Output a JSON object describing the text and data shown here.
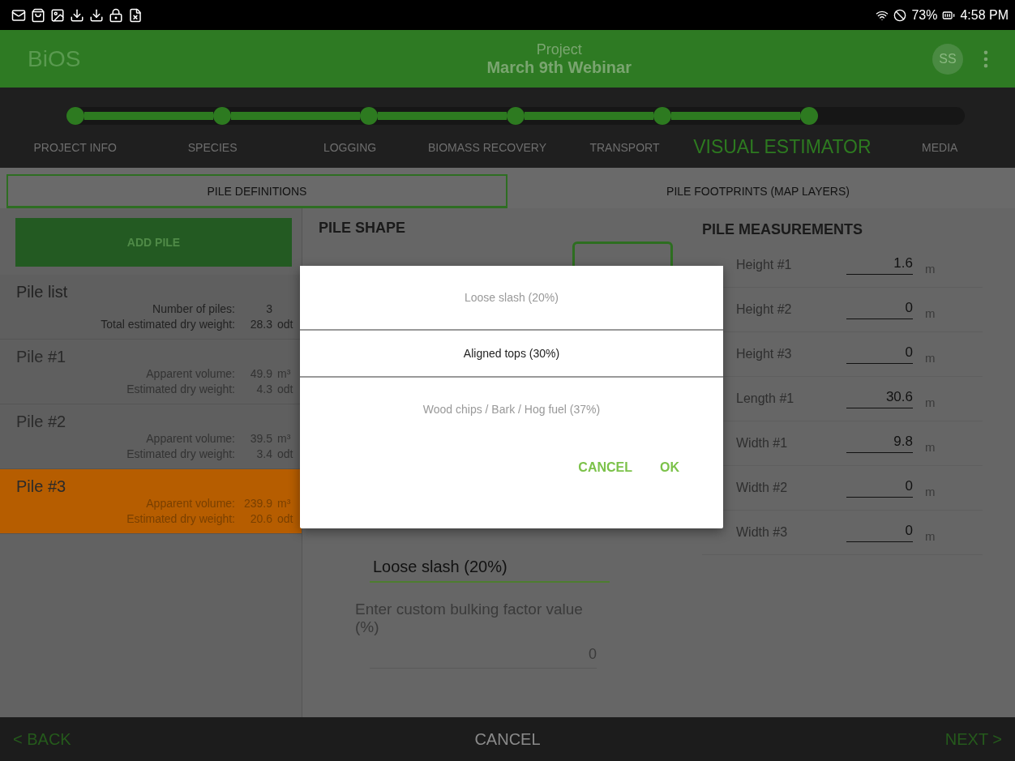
{
  "status_bar": {
    "battery": "73%",
    "time": "4:58 PM"
  },
  "header": {
    "app_name": "BiOS",
    "subtitle": "Project",
    "title": "March 9th Webinar",
    "avatar": "SS"
  },
  "steps": [
    {
      "label": "PROJECT INFO",
      "reached": true,
      "selected": false
    },
    {
      "label": "SPECIES",
      "reached": true,
      "selected": false
    },
    {
      "label": "LOGGING",
      "reached": true,
      "selected": false
    },
    {
      "label": "BIOMASS RECOVERY",
      "reached": true,
      "selected": false
    },
    {
      "label": "TRANSPORT",
      "reached": true,
      "selected": false
    },
    {
      "label": "VISUAL ESTIMATOR",
      "reached": true,
      "selected": true
    },
    {
      "label": "MEDIA",
      "reached": false,
      "selected": false
    }
  ],
  "tabs": [
    {
      "label": "PILE DEFINITIONS",
      "selected": true
    },
    {
      "label": "PILE FOOTPRINTS (MAP LAYERS)",
      "selected": false
    }
  ],
  "add_pile": "ADD PILE",
  "pile_list": {
    "title": "Pile list",
    "rows": [
      {
        "label": "Number of piles:",
        "value": "3",
        "unit": ""
      },
      {
        "label": "Total estimated dry weight:",
        "value": "28.3",
        "unit": "odt"
      }
    ]
  },
  "piles": [
    {
      "name": "Pile #1",
      "selected": false,
      "rows": [
        {
          "label": "Apparent volume:",
          "value": "49.9",
          "unit": "m³"
        },
        {
          "label": "Estimated dry weight:",
          "value": "4.3",
          "unit": "odt"
        }
      ]
    },
    {
      "name": "Pile #2",
      "selected": false,
      "rows": [
        {
          "label": "Apparent volume:",
          "value": "39.5",
          "unit": "m³"
        },
        {
          "label": "Estimated dry weight:",
          "value": "3.4",
          "unit": "odt"
        }
      ]
    },
    {
      "name": "Pile #3",
      "selected": true,
      "rows": [
        {
          "label": "Apparent volume:",
          "value": "239.9",
          "unit": "m³"
        },
        {
          "label": "Estimated dry weight:",
          "value": "20.6",
          "unit": "odt"
        }
      ]
    }
  ],
  "pile_shape": {
    "title": "PILE SHAPE",
    "bulking_factor": "Loose slash (20%)",
    "custom_label": "Enter custom bulking factor value (%)",
    "custom_value": "0"
  },
  "measurements": {
    "title": "PILE MEASUREMENTS",
    "rows": [
      {
        "label": "Height #1",
        "value": "1.6",
        "unit": "m"
      },
      {
        "label": "Height #2",
        "value": "0",
        "unit": "m"
      },
      {
        "label": "Height #3",
        "value": "0",
        "unit": "m"
      },
      {
        "label": "Length #1",
        "value": "30.6",
        "unit": "m"
      },
      {
        "label": "Width #1",
        "value": "9.8",
        "unit": "m"
      },
      {
        "label": "Width #2",
        "value": "0",
        "unit": "m"
      },
      {
        "label": "Width #3",
        "value": "0",
        "unit": "m"
      }
    ]
  },
  "footer": {
    "back": "< BACK",
    "cancel": "CANCEL",
    "next": "NEXT >"
  },
  "dialog": {
    "options": [
      {
        "label": "Loose slash (20%)",
        "selected": false
      },
      {
        "label": "Aligned tops (30%)",
        "selected": true
      },
      {
        "label": "Wood chips / Bark / Hog fuel (37%)",
        "selected": false
      }
    ],
    "buttons": [
      "CANCEL",
      "OK"
    ]
  }
}
